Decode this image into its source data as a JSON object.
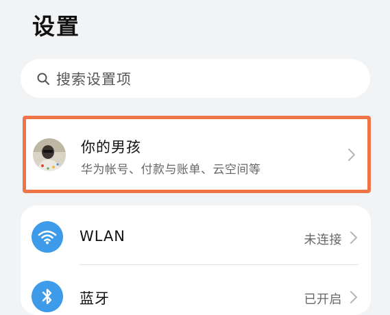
{
  "header": {
    "title": "设置"
  },
  "search": {
    "placeholder": "搜索设置项",
    "icon": "search-icon"
  },
  "account": {
    "name": "你的男孩",
    "subtitle": "华为帐号、付款与账单、云空间等",
    "highlight_color": "#ef7448"
  },
  "settings": {
    "items": [
      {
        "label": "WLAN",
        "status": "未连接",
        "icon": "wifi-icon"
      },
      {
        "label": "蓝牙",
        "status": "已开启",
        "icon": "bluetooth-icon"
      }
    ]
  },
  "colors": {
    "background": "#f1f3f5",
    "icon_blue": "#3d9be9",
    "card": "#ffffff"
  }
}
